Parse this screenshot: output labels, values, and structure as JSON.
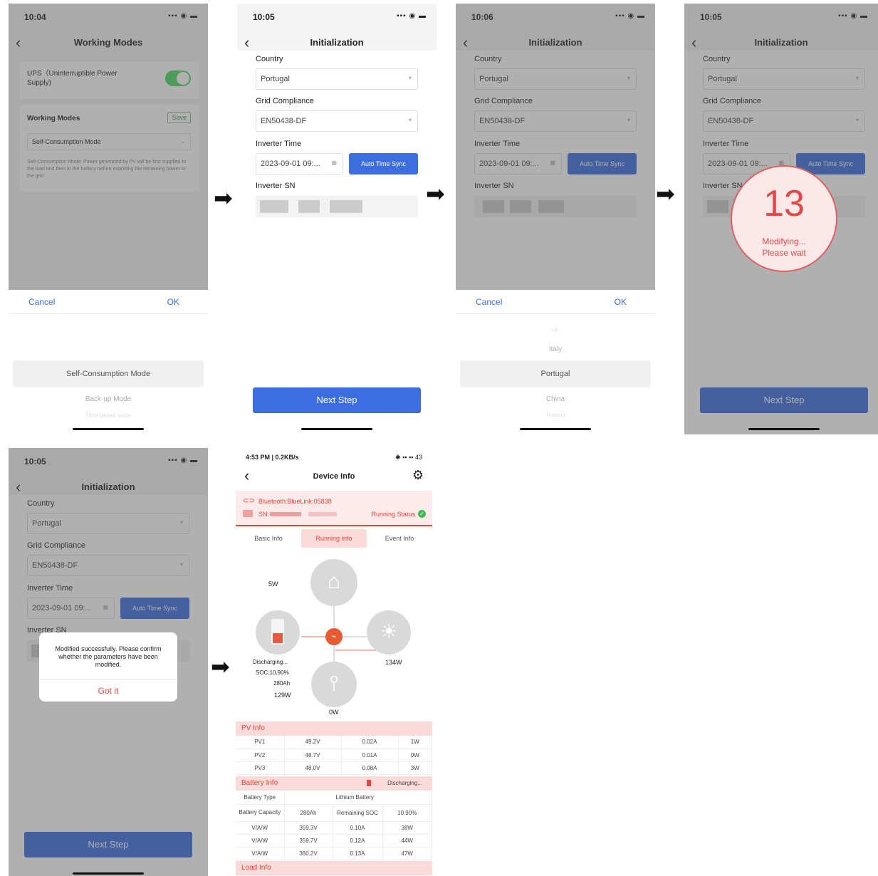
{
  "arrow_glyph": "➡",
  "screen1": {
    "time": "10:04",
    "status_icons": "▪▪▪ ◉ ▬",
    "back": "‹",
    "title": "Working Modes",
    "ups_label": "UPS（Uninterruptible Power Supply)",
    "section_title": "Working Modes",
    "save": "Save",
    "selected_mode": "Self-Consumption Mode",
    "description": "Self-Consumption Mode: Power generated by PV will be first supplied to the load and then to the battery before exporting the remaining power to the grid.",
    "cancel": "Cancel",
    "ok": "OK",
    "picker": [
      "Self-Consumption Mode",
      "Back-up Mode",
      "Time-based mode"
    ]
  },
  "screen2": {
    "time": "10:05",
    "status_icons": "▪▪▪ ◉ ▬",
    "back": "‹",
    "title": "Initialization",
    "country_label": "Country",
    "country": "Portugal",
    "grid_label": "Grid Compliance",
    "grid": "EN50438-DF",
    "time_label": "Inverter Time",
    "inverter_time": "2023-09-01 09:...",
    "auto_sync": "Auto Time Sync",
    "sn_label": "Inverter SN",
    "next": "Next Step"
  },
  "screen3": {
    "time": "10:06",
    "status_icons": "▪▪▪ ◉ ▬",
    "back": "‹",
    "title": "Initialization",
    "country_label": "Country",
    "country": "Portugal",
    "grid_label": "Grid Compliance",
    "grid": "EN50438-DF",
    "time_label": "Inverter Time",
    "inverter_time": "2023-09-01 09:...",
    "auto_sync": "Auto Time Sync",
    "sn_label": "Inverter SN",
    "cancel": "Cancel",
    "ok": "OK",
    "picker": [
      "UK",
      "Italy",
      "Portugal",
      "China",
      "Thailand"
    ]
  },
  "screen4": {
    "time": "10:05",
    "status_icons": "▪▪▪ ◉ ▬",
    "back": "‹",
    "title": "Initialization",
    "country_label": "Country",
    "country": "Portugal",
    "grid_label": "Grid Compliance",
    "grid": "EN50438-DF",
    "time_label": "Inverter Time",
    "inverter_time": "2023-09-01 09:...",
    "auto_sync": "Auto Time Sync",
    "sn_label": "Inverter SN",
    "countdown": "13",
    "modifying": "Modifying...",
    "please_wait": "Please wait",
    "next": "Next Step"
  },
  "screen5": {
    "time": "10:05",
    "status_icons": "▪▪▪ ◉ ▬",
    "back": "‹",
    "title": "Initialization",
    "country_label": "Country",
    "country": "Portugal",
    "grid_label": "Grid Compliance",
    "grid": "EN50438-DF",
    "time_label": "Inverter Time",
    "inverter_time": "2023-09-01 09:...",
    "auto_sync": "Auto Time Sync",
    "sn_label": "Inverter SN",
    "dialog_msg": "Modified successfully. Please confirm whether the parameters have been modified.",
    "got_it": "Got it",
    "next": "Next Step"
  },
  "screen6": {
    "status_left": "4:53 PM | 0.2KB/s",
    "status_right": "✱ ▪▪ ▪▪ 43",
    "back": "‹",
    "title": "Device Info",
    "bluetooth": "Bluetooth:BlueLink:05838",
    "sn_label": "SN:",
    "running_status": "Running Status",
    "tabs": [
      "Basic Info",
      "Running Info",
      "Event Info"
    ],
    "flow": {
      "home_power": "5W",
      "battery_state": "Discharging...",
      "soc": "SOC:10.90%",
      "capacity": "280Ah",
      "battery_power": "129W",
      "load_power": "134W",
      "grid_power": "0W"
    },
    "pv_head": "PV Info",
    "pv_rows": [
      [
        "PV1",
        "49.2V",
        "0.02A",
        "1W"
      ],
      [
        "PV2",
        "48.7V",
        "0.01A",
        "0W"
      ],
      [
        "PV3",
        "48.0V",
        "0.08A",
        "3W"
      ]
    ],
    "battery_head": "Battery Info",
    "battery_status": "Discharging...",
    "battery_type_label": "Battery Type",
    "battery_type": "Lithium Battery",
    "capacity_label": "Battery Capacity",
    "capacity": "280Ah",
    "remaining_label": "Remaining SOC",
    "remaining": "10.90%",
    "vaw_rows": [
      [
        "V/A/W",
        "359.3V",
        "0.10A",
        "38W"
      ],
      [
        "V/A/W",
        "359.7V",
        "0.12A",
        "44W"
      ],
      [
        "V/A/W",
        "360.2V",
        "0.13A",
        "47W"
      ]
    ],
    "load_head": "Load Info"
  }
}
